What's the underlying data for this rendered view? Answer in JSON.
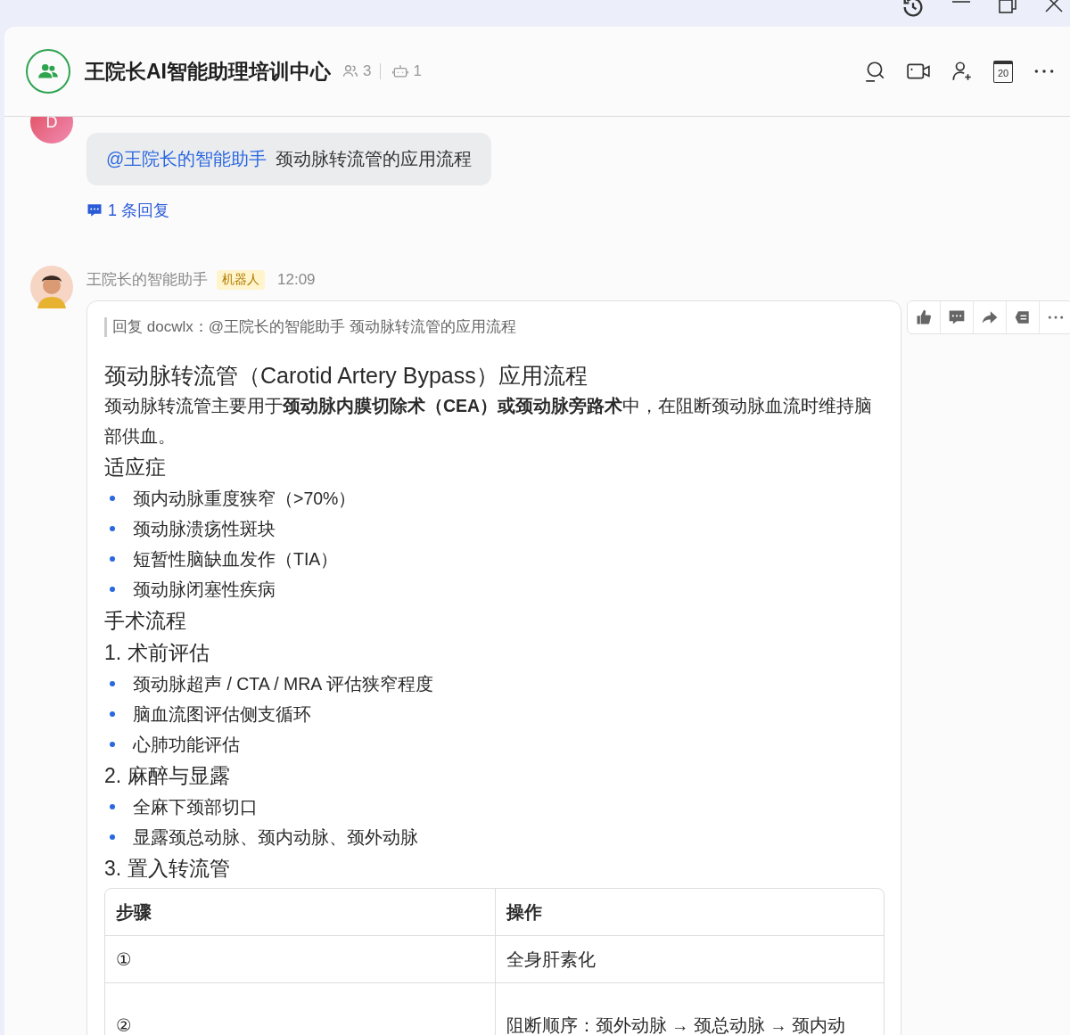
{
  "header": {
    "title": "王院长AI智能助理培训中心",
    "members": "3",
    "bots": "1",
    "calendar_day": "20"
  },
  "user_message": {
    "avatar_letter": "D",
    "mention": "@王院长的智能助手",
    "text": "颈动脉转流管的应用流程",
    "replies": "1 条回复"
  },
  "bot_message": {
    "sender": "王院长的智能助手",
    "badge": "机器人",
    "time": "12:09",
    "quote": "回复 docwlx：@王院长的智能助手 颈动脉转流管的应用流程",
    "blocks": [
      {
        "kind": "heading",
        "text": "颈动脉转流管（Carotid Artery Bypass）应用流程"
      },
      {
        "kind": "paragraph",
        "text": "颈动脉转流管主要用于**颈动脉内膜切除术（CEA）或颈动脉旁路术**中，在阻断颈动脉血流时维持脑部供血。"
      },
      {
        "kind": "subheading",
        "text": "适应症"
      },
      {
        "kind": "bullets",
        "items": [
          "颈内动脉重度狭窄（>70%）",
          "颈动脉溃疡性斑块",
          "短暂性脑缺血发作（TIA）",
          "颈动脉闭塞性疾病"
        ]
      },
      {
        "kind": "subheading",
        "text": "手术流程"
      },
      {
        "kind": "subheading",
        "text": "1. 术前评估"
      },
      {
        "kind": "bullets",
        "items": [
          "颈动脉超声 / CTA / MRA 评估狭窄程度",
          "脑血流图评估侧支循环",
          "心肺功能评估"
        ]
      },
      {
        "kind": "subheading",
        "text": "2. 麻醉与显露"
      },
      {
        "kind": "bullets",
        "items": [
          "全麻下颈部切口",
          "显露颈总动脉、颈内动脉、颈外动脉"
        ]
      },
      {
        "kind": "subheading",
        "text": "3. 置入转流管"
      },
      {
        "kind": "table",
        "columns": [
          "步骤",
          "操作"
        ],
        "rows": [
          [
            "①",
            "全身肝素化"
          ],
          [
            "②",
            "阻断顺序：颈外动脉 → 颈总动脉 → 颈内动"
          ]
        ]
      }
    ]
  }
}
